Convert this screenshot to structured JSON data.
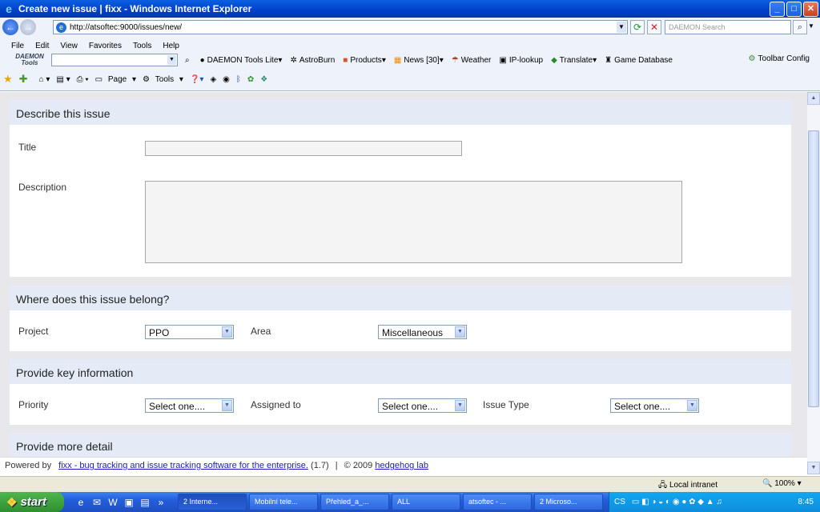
{
  "window": {
    "title": "Create new issue | fixx - Windows Internet Explorer"
  },
  "address": {
    "url": "http://atsoftec:9000/issues/new/"
  },
  "search": {
    "placeholder": "DAEMON Search"
  },
  "menu": [
    "File",
    "Edit",
    "View",
    "Favorites",
    "Tools",
    "Help"
  ],
  "daemon_toolbar": {
    "logo": "DAEMON Tools",
    "items": [
      "DAEMON Tools Lite",
      "AstroBurn",
      "Products",
      "News [30]",
      "Weather",
      "IP-lookup",
      "Translate",
      "Game Database"
    ],
    "config": "Toolbar Config"
  },
  "command_bar": {
    "page": "Page",
    "tools": "Tools"
  },
  "form": {
    "section1": {
      "heading": "Describe this issue",
      "title_label": "Title",
      "title_value": "",
      "description_label": "Description",
      "description_value": ""
    },
    "section2": {
      "heading": "Where does this issue belong?",
      "project_label": "Project",
      "project_value": "PPO",
      "area_label": "Area",
      "area_value": "Miscellaneous"
    },
    "section3": {
      "heading": "Provide key information",
      "priority_label": "Priority",
      "priority_value": "Select one....",
      "assigned_label": "Assigned to",
      "assigned_value": "Select one....",
      "type_label": "Issue Type",
      "type_value": "Select one...."
    },
    "section4": {
      "heading": "Provide more detail"
    }
  },
  "footer": {
    "powered": "Powered by",
    "link": "fixx -  bug tracking and issue tracking software for the enterprise.",
    "version": "(1.7)",
    "sep": "|",
    "copy": "© 2009",
    "lab": "hedgehog lab"
  },
  "status": {
    "zone": "Local intranet",
    "zoom": "100%"
  },
  "taskbar": {
    "start": "start",
    "tasks": [
      "2 Interne...",
      "Mobilní tele...",
      "Přehled_a_...",
      "ALL",
      "atsoftec - ...",
      "2 Microso..."
    ],
    "lang": "CS",
    "clock": "8:45"
  },
  "colors": {
    "title_blue": "#0040c8",
    "section_head": "#e4ebf7",
    "page_bg": "#e8e8ec",
    "taskbar": "#245edb"
  }
}
